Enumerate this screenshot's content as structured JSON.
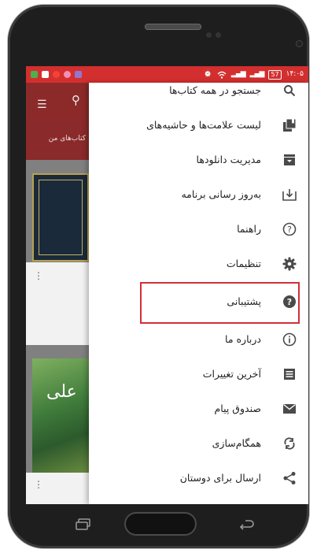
{
  "status_bar": {
    "time": "۱۴:۰۵",
    "battery": "57",
    "left_icon_colors": [
      "#4caf50",
      "#ffffff",
      "#f44336",
      "#f48fb1",
      "#9575cd"
    ]
  },
  "background_app": {
    "tab_label": "کتاب‌های من",
    "book2_text": "علی"
  },
  "drawer": {
    "items": [
      {
        "label": "جستجو در همه کتاب‌ها",
        "icon": "search-icon"
      },
      {
        "label": "لیست علامت‌ها و حاشیه‌های",
        "icon": "bookmarks-icon"
      },
      {
        "label": "مدیریت دانلودها",
        "icon": "archive-box-icon"
      },
      {
        "label": "به‌روز رسانی برنامه",
        "icon": "download-update-icon"
      },
      {
        "label": "راهنما",
        "icon": "help-outline-icon"
      },
      {
        "label": "تنظیمات",
        "icon": "gear-icon"
      },
      {
        "label": "پشتیبانی",
        "icon": "help-filled-icon"
      },
      {
        "label": "درباره ما",
        "icon": "info-icon"
      },
      {
        "label": "آخرین تغییرات",
        "icon": "list-icon"
      },
      {
        "label": "صندوق پیام",
        "icon": "mail-icon"
      },
      {
        "label": "همگام‌سازی",
        "icon": "sync-icon"
      },
      {
        "label": "ارسال برای دوستان",
        "icon": "share-icon"
      }
    ],
    "highlighted_index": 6
  },
  "colors": {
    "status_bar": "#d32f2f",
    "highlight_border": "#d0303a",
    "icon_gray": "#4a4a4a"
  }
}
